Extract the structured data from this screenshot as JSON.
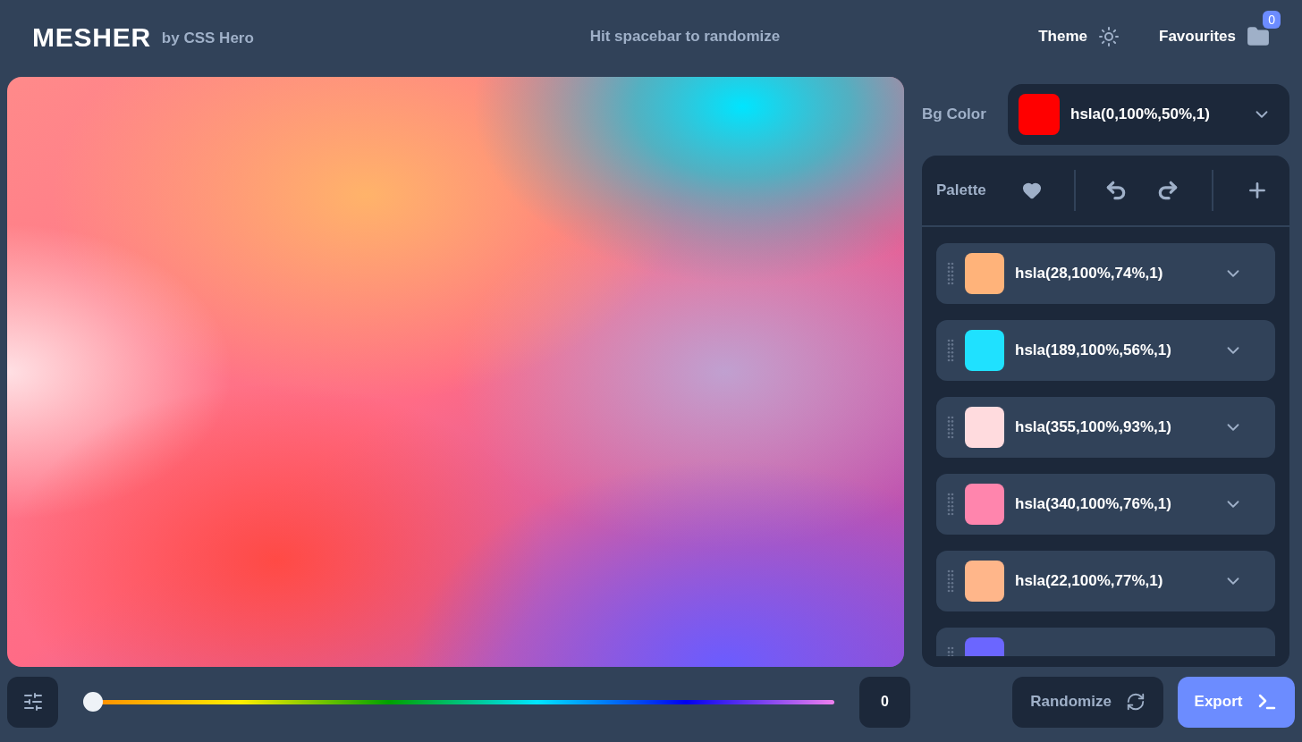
{
  "header": {
    "logo": "MESHER",
    "byline": "by CSS Hero",
    "hint": "Hit spacebar to randomize",
    "theme_label": "Theme",
    "favourites_label": "Favourites",
    "favourites_count": "0"
  },
  "bg_color": {
    "label": "Bg Color",
    "value": "hsla(0,100%,50%,1)",
    "color": "#ff0000"
  },
  "palette": {
    "label": "Palette",
    "items": [
      {
        "value": "hsla(28,100%,74%,1)",
        "color": "#ffb37a"
      },
      {
        "value": "hsla(189,100%,56%,1)",
        "color": "#1fe1ff"
      },
      {
        "value": "hsla(355,100%,93%,1)",
        "color": "#ffdbde"
      },
      {
        "value": "hsla(340,100%,76%,1)",
        "color": "#ff85ad"
      },
      {
        "value": "hsla(22,100%,77%,1)",
        "color": "#ffb68a"
      },
      {
        "color": "#6b66ff"
      }
    ]
  },
  "hue": {
    "level": 0,
    "value": "0"
  },
  "buttons": {
    "randomize": "Randomize",
    "export": "Export"
  }
}
